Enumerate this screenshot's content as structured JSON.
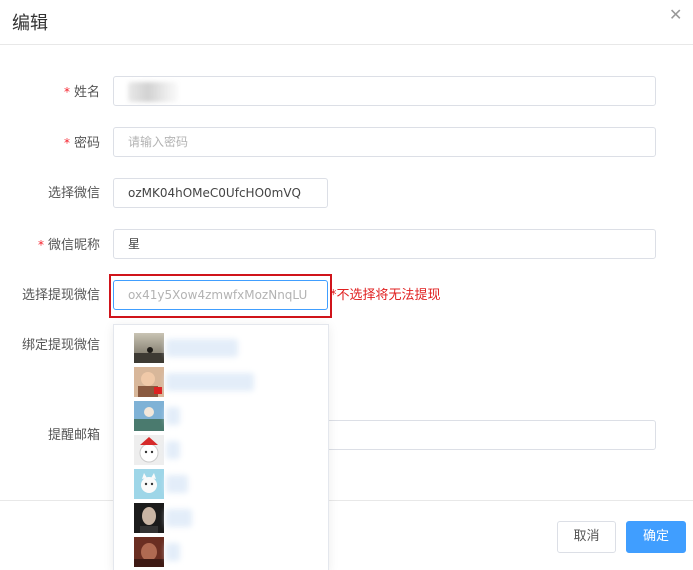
{
  "dialog": {
    "title": "编辑",
    "close_icon": "close-icon"
  },
  "form": {
    "required_mark": "*",
    "name": {
      "label": "姓名",
      "value": ""
    },
    "password": {
      "label": "密码",
      "placeholder": "请输入密码"
    },
    "select_wechat": {
      "label": "选择微信",
      "value": "ozMK04hOMeC0UfcHO0mVQ"
    },
    "wechat_nickname": {
      "label": "微信昵称",
      "value": "星"
    },
    "select_withdraw_wechat": {
      "label": "选择提现微信",
      "placeholder": "ox41y5Xow4zmwfxMozNnqLU",
      "hint": "*不选择将无法提现"
    },
    "bind_withdraw_wechat": {
      "label": "绑定提现微信"
    },
    "reminder_email": {
      "label": "提醒邮箱",
      "value": ""
    }
  },
  "dropdown": {
    "options": [
      {
        "avatar": "avatar-landscape"
      },
      {
        "avatar": "avatar-person"
      },
      {
        "avatar": "avatar-person-sky"
      },
      {
        "avatar": "avatar-cartoon-hat"
      },
      {
        "avatar": "avatar-cartoon-cat"
      },
      {
        "avatar": "avatar-portrait-dark"
      },
      {
        "avatar": "avatar-portrait-red"
      }
    ]
  },
  "footer": {
    "cancel_label": "取消",
    "ok_label": "确定"
  },
  "colors": {
    "primary": "#409eff",
    "required": "#f5222d",
    "hint": "#e02020",
    "highlight": "#d0141b"
  }
}
